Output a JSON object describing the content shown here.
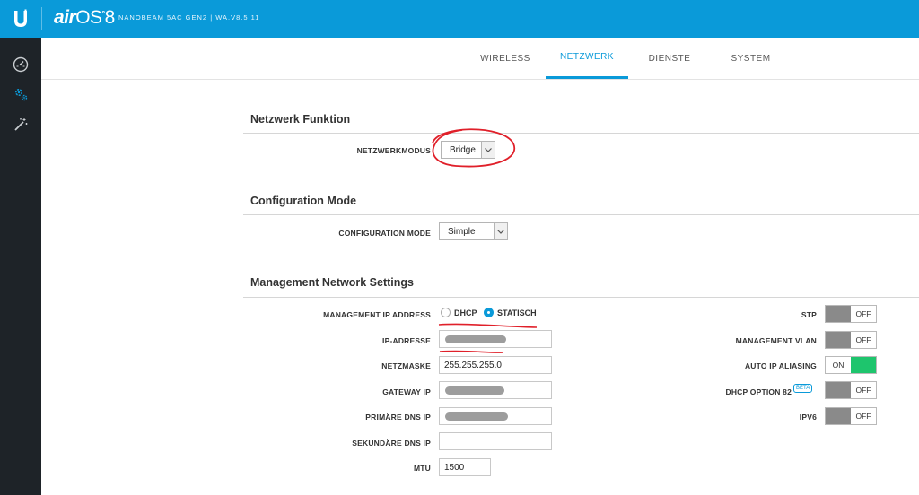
{
  "header": {
    "brand_prefix": "air",
    "brand_os": "OS",
    "brand_version": "8",
    "device_info": "NANOBEAM 5AC GEN2 | WA.V8.5.11"
  },
  "sidebar": {
    "items": [
      {
        "icon": "dashboard-icon"
      },
      {
        "icon": "settings-gears-icon"
      },
      {
        "icon": "tools-wand-icon"
      }
    ]
  },
  "tabs": [
    {
      "label": "WIRELESS",
      "active": false
    },
    {
      "label": "NETZWERK",
      "active": true
    },
    {
      "label": "DIENSTE",
      "active": false
    },
    {
      "label": "SYSTEM",
      "active": false
    }
  ],
  "network_function": {
    "title": "Netzwerk Funktion",
    "mode_label": "NETZWERKMODUS",
    "mode_value": "Bridge"
  },
  "configuration": {
    "title": "Configuration Mode",
    "mode_label": "CONFIGURATION MODE",
    "mode_value": "Simple"
  },
  "management": {
    "title": "Management Network Settings",
    "ip_address_label": "MANAGEMENT IP ADDRESS",
    "dhcp_label": "DHCP",
    "static_label": "STATISCH",
    "ip_label": "IP-ADRESSE",
    "netmask_label": "NETZMASKE",
    "netmask_value": "255.255.255.0",
    "gateway_label": "GATEWAY IP",
    "dns1_label": "PRIMÄRE DNS IP",
    "dns2_label": "SEKUNDÄRE DNS IP",
    "mtu_label": "MTU",
    "mtu_value": "1500",
    "stp_label": "STP",
    "stp_value": "OFF",
    "vlan_label": "MANAGEMENT VLAN",
    "vlan_value": "OFF",
    "alias_label": "AUTO IP ALIASING",
    "alias_value": "ON",
    "dhcp82_label": "DHCP OPTION 82",
    "beta_label": "BETA",
    "dhcp82_value": "OFF",
    "ipv6_label": "IPV6",
    "ipv6_value": "OFF"
  },
  "colors": {
    "accent": "#0a9ad9",
    "sidebar": "#1e2328",
    "toggle_on": "#1ec56d",
    "toggle_off": "#8a8a8a",
    "annotation": "#e0202a"
  }
}
